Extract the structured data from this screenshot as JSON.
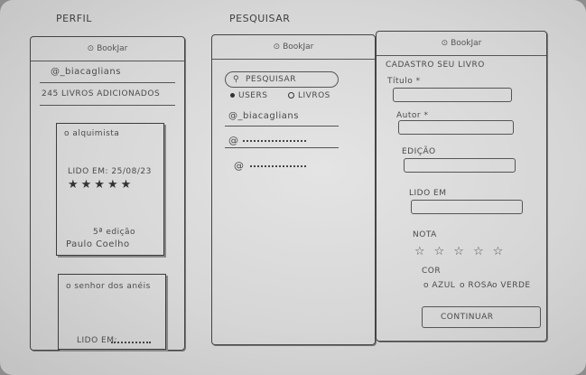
{
  "sections": {
    "perfil": "PERFIL",
    "pesquisar": "PESQUISAR"
  },
  "brand": "BookJar",
  "profile": {
    "handle": "@_biacaglians",
    "books_count": "245 LIVROS ADICIONADOS",
    "card1": {
      "title": "o alquimista",
      "read_date": "LIDO EM: 25/08/23",
      "stars": "★★★★★",
      "edition": "5ª edição",
      "author": "Paulo Coelho"
    },
    "card2": {
      "title": "o senhor dos anéis",
      "read_label": "LIDO EM:"
    }
  },
  "search": {
    "placeholder": "PESQUISAR",
    "filter_users": "USERS",
    "filter_books": "LIVROS",
    "results": [
      "@_biacaglians",
      "@",
      "@"
    ]
  },
  "register": {
    "heading": "CADASTRO SEU LIVRO",
    "title_label": "Título *",
    "author_label": "Autor *",
    "edition_label": "EDIÇÃO",
    "read_label": "LIDO EM",
    "rating_label": "NOTA",
    "stars": "☆☆☆☆☆",
    "color_label": "COR",
    "color_options": [
      "o AZUL",
      "o ROSA",
      "o VERDE"
    ],
    "continue_label": "CONTINUAR"
  }
}
